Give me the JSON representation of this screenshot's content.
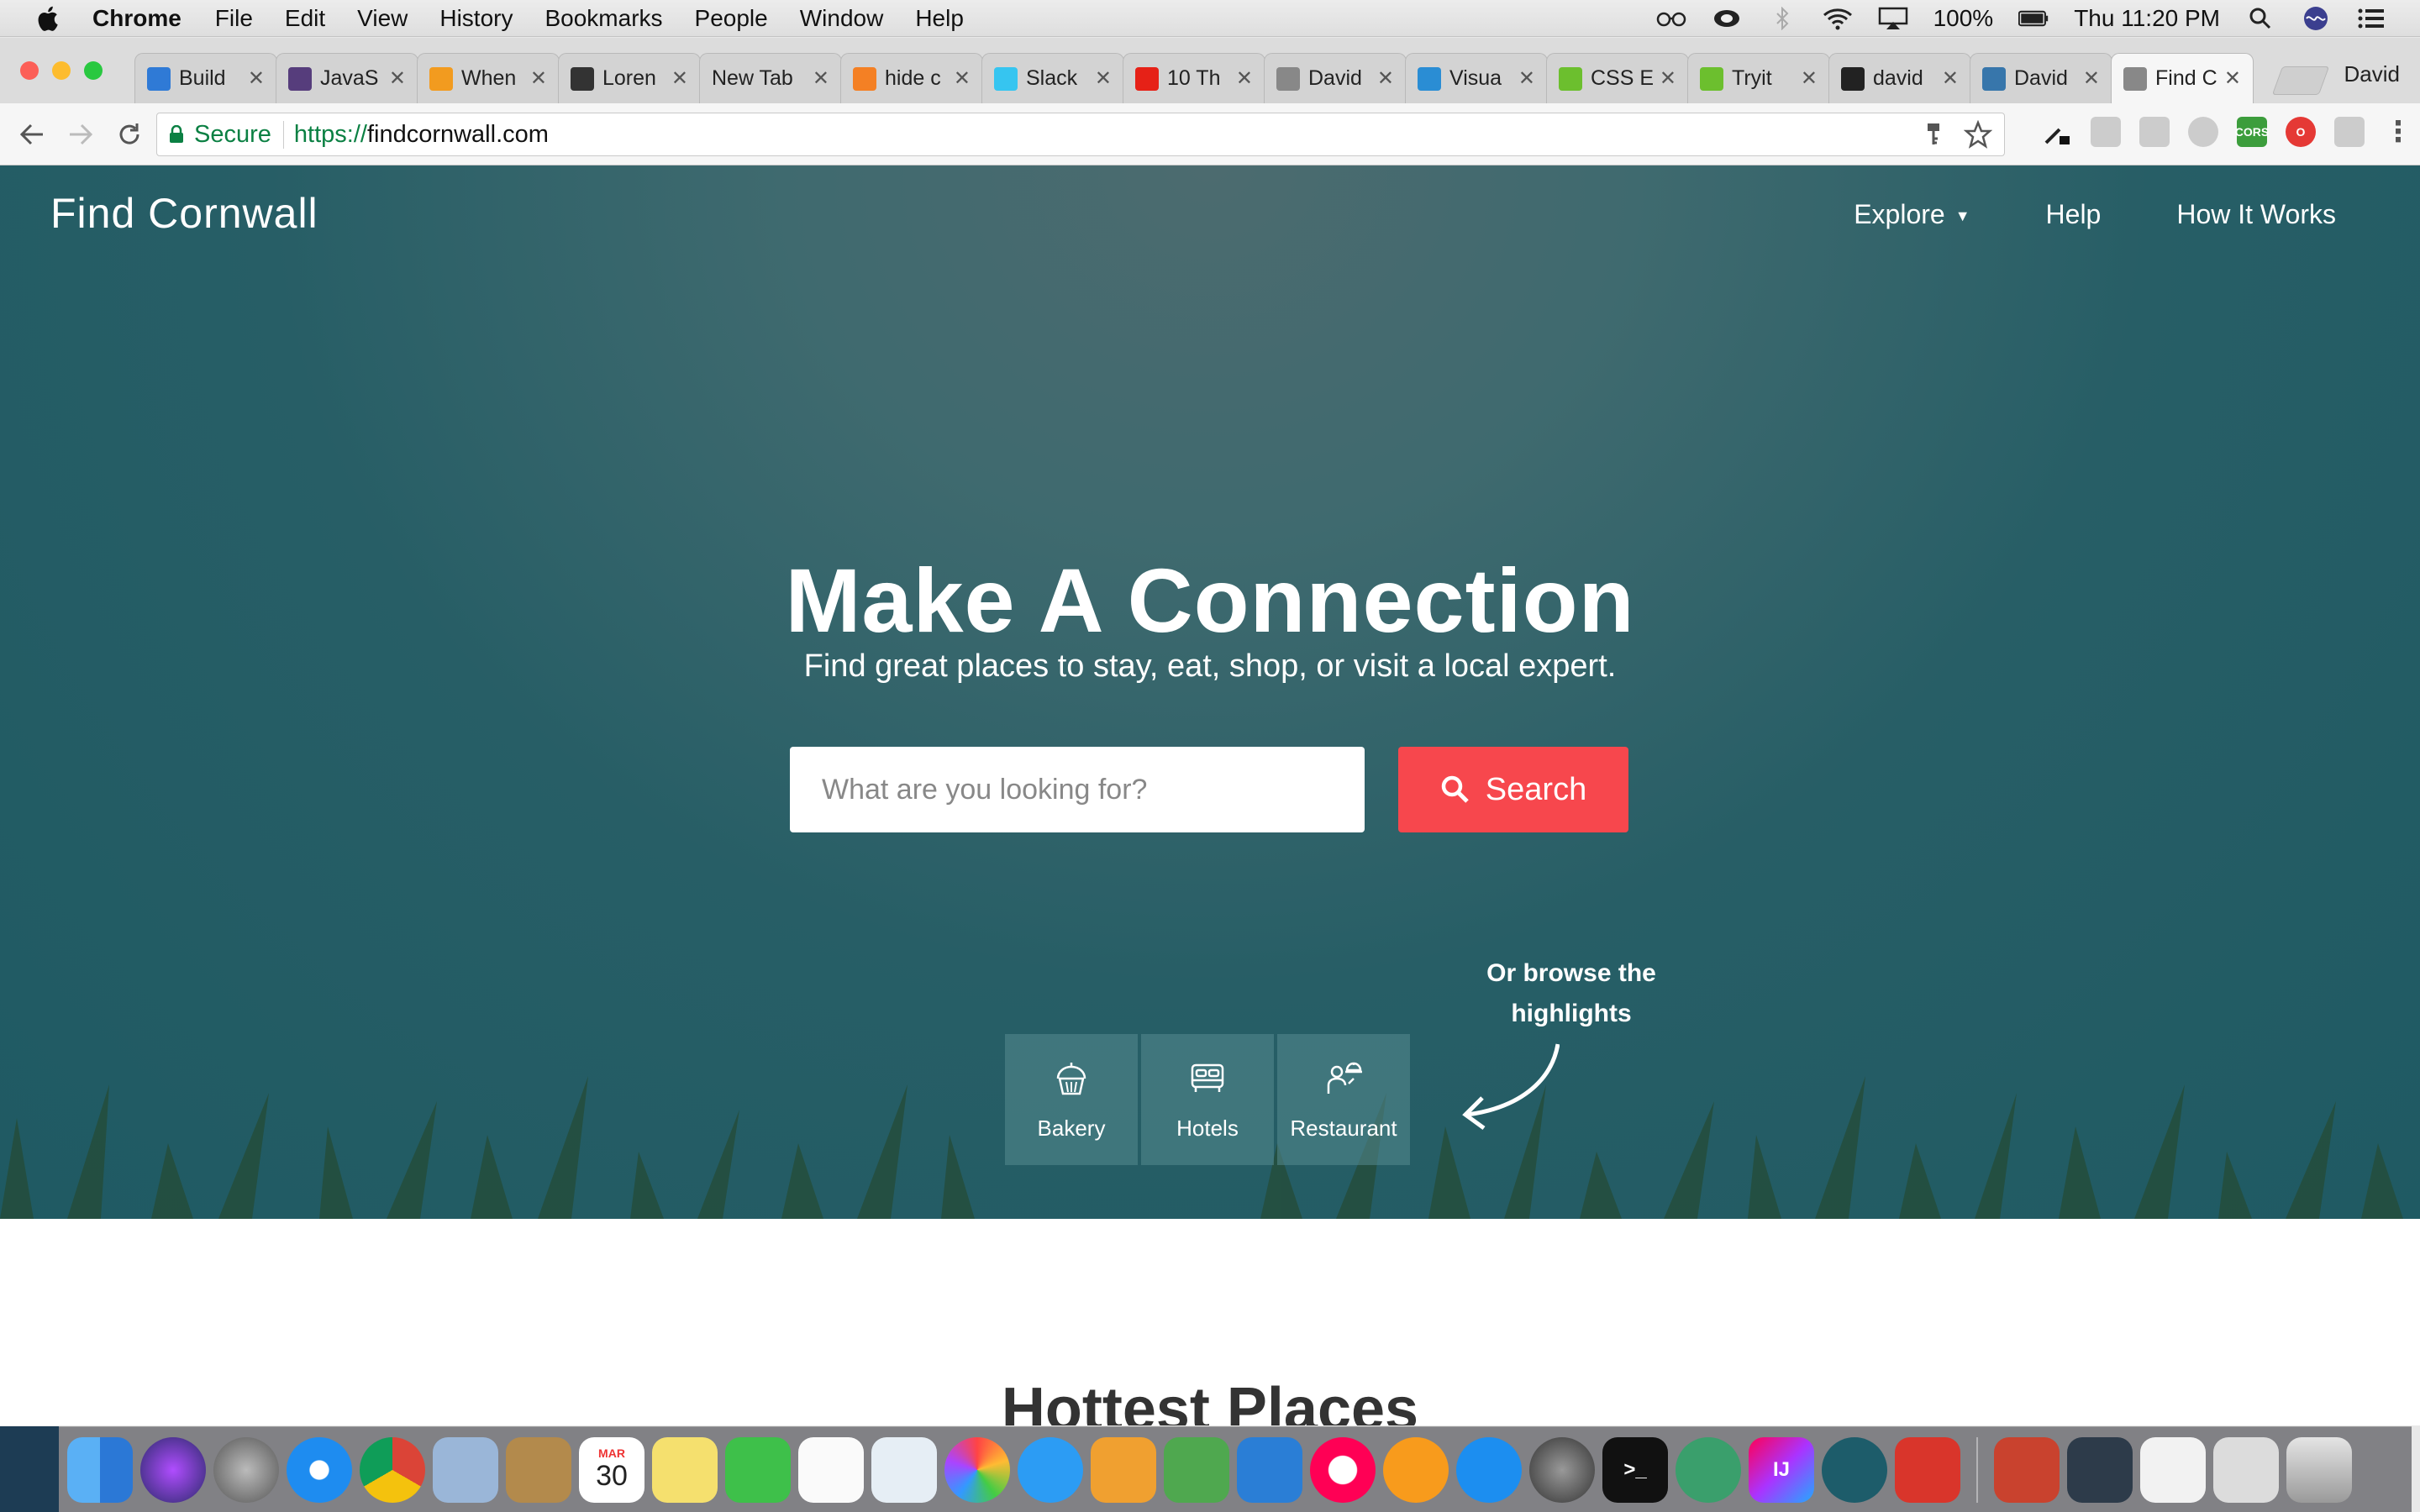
{
  "menubar": {
    "app": "Chrome",
    "items": [
      "File",
      "Edit",
      "View",
      "History",
      "Bookmarks",
      "People",
      "Window",
      "Help"
    ],
    "battery": "100%",
    "clock": "Thu 11:20 PM"
  },
  "tabs": [
    {
      "title": "Build",
      "color": "#2f7ad6"
    },
    {
      "title": "JavaS",
      "color": "#563d7c"
    },
    {
      "title": "When",
      "color": "#f29b1f"
    },
    {
      "title": "Loren",
      "color": "#333333"
    },
    {
      "title": "New Tab",
      "color": ""
    },
    {
      "title": "hide c",
      "color": "#f48024"
    },
    {
      "title": "Slack",
      "color": "#36c5f0"
    },
    {
      "title": "10 Th",
      "color": "#e62117"
    },
    {
      "title": "David",
      "color": "#888888"
    },
    {
      "title": "Visua",
      "color": "#2a8dd4"
    },
    {
      "title": "CSS E",
      "color": "#6cbf2e"
    },
    {
      "title": "Tryit",
      "color": "#6cbf2e"
    },
    {
      "title": "david",
      "color": "#222222"
    },
    {
      "title": "David",
      "color": "#3776ab"
    },
    {
      "title": "Find C",
      "color": "#888888"
    }
  ],
  "profile": "David",
  "omnibox": {
    "secure": "Secure",
    "scheme": "https://",
    "host": "findcornwall.com"
  },
  "site": {
    "brand": "Find Cornwall",
    "nav": [
      "Explore",
      "Help",
      "How It Works"
    ],
    "hero_title": "Make A Connection",
    "hero_subtitle": "Find great places to stay, eat, shop, or visit a local expert.",
    "search_placeholder": "What are you looking for?",
    "search_button": "Search",
    "browse_note_line1": "Or browse the",
    "browse_note_line2": "highlights",
    "categories": [
      "Bakery",
      "Hotels",
      "Restaurant"
    ],
    "section_title": "Hottest Places"
  },
  "colors": {
    "accent": "#f7474d",
    "hero": "#1f5a63",
    "secure_green": "#0b8043"
  },
  "dock": {
    "calendar_month": "MAR",
    "calendar_day": "30"
  }
}
